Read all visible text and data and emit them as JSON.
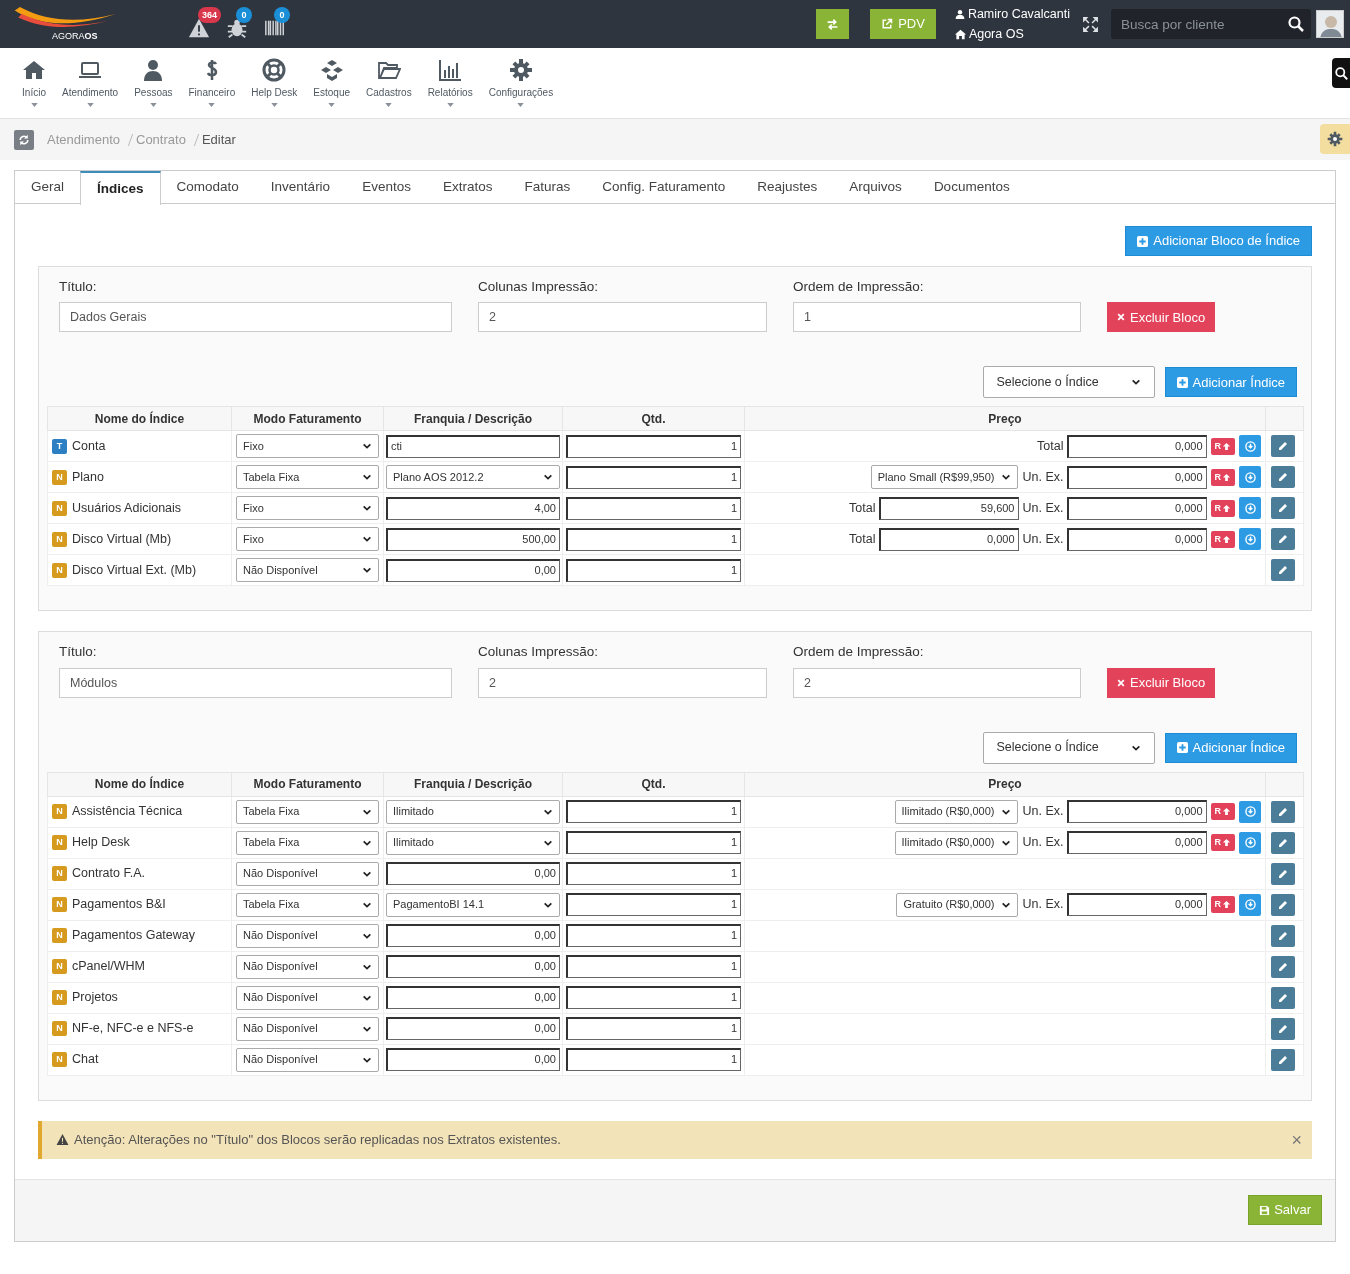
{
  "topbar": {
    "logo": "AGORA**OS**",
    "notifications": [
      {
        "count": "364",
        "color": "#d9374b"
      },
      {
        "count": "0",
        "color": "#1a8fd8"
      },
      {
        "count": "0",
        "color": "#1a8fd8"
      }
    ],
    "pdv_button": "PDV",
    "user_name": "Ramiro Cavalcanti",
    "company": "Agora OS",
    "search": {
      "placeholder": "Busca por cliente"
    }
  },
  "menu": [
    {
      "label": "Início"
    },
    {
      "label": "Atendimento"
    },
    {
      "label": "Pessoas"
    },
    {
      "label": "Financeiro"
    },
    {
      "label": "Help Desk"
    },
    {
      "label": "Estoque"
    },
    {
      "label": "Cadastros"
    },
    {
      "label": "Relatórios"
    },
    {
      "label": "Configurações"
    }
  ],
  "breadcrumb": [
    "Atendimento",
    "Contrato",
    "Editar"
  ],
  "tabs": [
    {
      "label": "Geral",
      "selected": false
    },
    {
      "label": "Índices",
      "selected": true
    },
    {
      "label": "Comodato",
      "selected": false
    },
    {
      "label": "Inventário",
      "selected": false
    },
    {
      "label": "Eventos",
      "selected": false
    },
    {
      "label": "Extratos",
      "selected": false
    },
    {
      "label": "Faturas",
      "selected": false
    },
    {
      "label": "Config. Faturamento",
      "selected": false
    },
    {
      "label": "Reajustes",
      "selected": false
    },
    {
      "label": "Arquivos",
      "selected": false
    },
    {
      "label": "Documentos",
      "selected": false
    }
  ],
  "add_block_button": "Adicionar Bloco de Índice",
  "blocks": [
    {
      "title_label": "Título:",
      "title": "Dados Gerais",
      "columns_label": "Colunas Impressão:",
      "columns": "2",
      "order_label": "Ordem de Impressão:",
      "order": "1",
      "delete_button": "Excluir Bloco",
      "index_select": "Selecione o Índice",
      "add_index_button": "Adicionar Índice",
      "headers": [
        "Nome do Índice",
        "Modo Faturamento",
        "Franquia / Descrição",
        "Qtd.",
        "Preço"
      ],
      "rows": [
        {
          "badge": "T",
          "kind": "table",
          "name": "Conta",
          "mode": "Fixo",
          "franchise": {
            "kind": "text",
            "value": "cti"
          },
          "qty": "1",
          "price": [
            {
              "kind": "label",
              "text": "Total"
            },
            {
              "kind": "input",
              "value": "0,000"
            },
            {
              "kind": "actions",
              "label": "R"
            }
          ]
        },
        {
          "badge": "N",
          "kind": "number",
          "name": "Plano",
          "mode": "Tabela Fixa",
          "franchise": {
            "kind": "select",
            "value": "Plano AOS 2012.2"
          },
          "qty": "1",
          "price": [
            {
              "kind": "select",
              "value": "Plano Small (R$99,950)"
            },
            {
              "kind": "label",
              "text": "Un. Ex."
            },
            {
              "kind": "input",
              "value": "0,000"
            },
            {
              "kind": "actions",
              "label": "R"
            }
          ]
        },
        {
          "badge": "N",
          "kind": "number",
          "name": "Usuários Adicionais",
          "mode": "Fixo",
          "franchise": {
            "kind": "number",
            "value": "4,00"
          },
          "qty": "1",
          "price": [
            {
              "kind": "label",
              "text": "Total"
            },
            {
              "kind": "input",
              "value": "59,600"
            },
            {
              "kind": "label",
              "text": "Un. Ex."
            },
            {
              "kind": "input",
              "value": "0,000"
            },
            {
              "kind": "actions",
              "label": "R"
            }
          ]
        },
        {
          "badge": "N",
          "kind": "number",
          "name": "Disco Virtual (Mb)",
          "mode": "Fixo",
          "franchise": {
            "kind": "number",
            "value": "500,00"
          },
          "qty": "1",
          "price": [
            {
              "kind": "label",
              "text": "Total"
            },
            {
              "kind": "input",
              "value": "0,000"
            },
            {
              "kind": "label",
              "text": "Un. Ex."
            },
            {
              "kind": "input",
              "value": "0,000"
            },
            {
              "kind": "actions",
              "label": "R"
            }
          ]
        },
        {
          "badge": "N",
          "kind": "number",
          "name": "Disco Virtual Ext. (Mb)",
          "mode": "Não Disponível",
          "franchise": {
            "kind": "number",
            "value": "0,00"
          },
          "qty": "1",
          "price": []
        }
      ]
    },
    {
      "title_label": "Título:",
      "title": "Módulos",
      "columns_label": "Colunas Impressão:",
      "columns": "2",
      "order_label": "Ordem de Impressão:",
      "order": "2",
      "delete_button": "Excluir Bloco",
      "index_select": "Selecione o Índice",
      "add_index_button": "Adicionar Índice",
      "headers": [
        "Nome do Índice",
        "Modo Faturamento",
        "Franquia / Descrição",
        "Qtd.",
        "Preço"
      ],
      "rows": [
        {
          "badge": "N",
          "kind": "number",
          "name": "Assistência Técnica",
          "mode": "Tabela Fixa",
          "franchise": {
            "kind": "select",
            "value": "Ilimitado"
          },
          "qty": "1",
          "price": [
            {
              "kind": "select",
              "value": "Ilimitado (R$0,000)"
            },
            {
              "kind": "label",
              "text": "Un. Ex."
            },
            {
              "kind": "input",
              "value": "0,000"
            },
            {
              "kind": "actions",
              "label": "R"
            }
          ]
        },
        {
          "badge": "N",
          "kind": "number",
          "name": "Help Desk",
          "mode": "Tabela Fixa",
          "franchise": {
            "kind": "select",
            "value": "Ilimitado"
          },
          "qty": "1",
          "price": [
            {
              "kind": "select",
              "value": "Ilimitado (R$0,000)"
            },
            {
              "kind": "label",
              "text": "Un. Ex."
            },
            {
              "kind": "input",
              "value": "0,000"
            },
            {
              "kind": "actions",
              "label": "R"
            }
          ]
        },
        {
          "badge": "N",
          "kind": "number",
          "name": "Contrato F.A.",
          "mode": "Não Disponível",
          "franchise": {
            "kind": "number",
            "value": "0,00"
          },
          "qty": "1",
          "price": []
        },
        {
          "badge": "N",
          "kind": "number",
          "name": "Pagamentos B&I",
          "mode": "Tabela Fixa",
          "franchise": {
            "kind": "select",
            "value": "PagamentoBI 14.1"
          },
          "qty": "1",
          "price": [
            {
              "kind": "select",
              "value": "Gratuito (R$0,000)"
            },
            {
              "kind": "label",
              "text": "Un. Ex."
            },
            {
              "kind": "input",
              "value": "0,000"
            },
            {
              "kind": "actions",
              "label": "R"
            }
          ]
        },
        {
          "badge": "N",
          "kind": "number",
          "name": "Pagamentos Gateway",
          "mode": "Não Disponível",
          "franchise": {
            "kind": "number",
            "value": "0,00"
          },
          "qty": "1",
          "price": []
        },
        {
          "badge": "N",
          "kind": "number",
          "name": "cPanel/WHM",
          "mode": "Não Disponível",
          "franchise": {
            "kind": "number",
            "value": "0,00"
          },
          "qty": "1",
          "price": []
        },
        {
          "badge": "N",
          "kind": "number",
          "name": "Projetos",
          "mode": "Não Disponível",
          "franchise": {
            "kind": "number",
            "value": "0,00"
          },
          "qty": "1",
          "price": []
        },
        {
          "badge": "N",
          "kind": "number",
          "name": "NF-e, NFC-e e NFS-e",
          "mode": "Não Disponível",
          "franchise": {
            "kind": "number",
            "value": "0,00"
          },
          "qty": "1",
          "price": []
        },
        {
          "badge": "N",
          "kind": "number",
          "name": "Chat",
          "mode": "Não Disponível",
          "franchise": {
            "kind": "number",
            "value": "0,00"
          },
          "qty": "1",
          "price": []
        }
      ]
    }
  ],
  "alert": {
    "text": "Atenção: Alterações no \"Título\" dos Blocos serão replicadas nos Extratos existentes.",
    "close": "×"
  },
  "save_button": "Salvar"
}
